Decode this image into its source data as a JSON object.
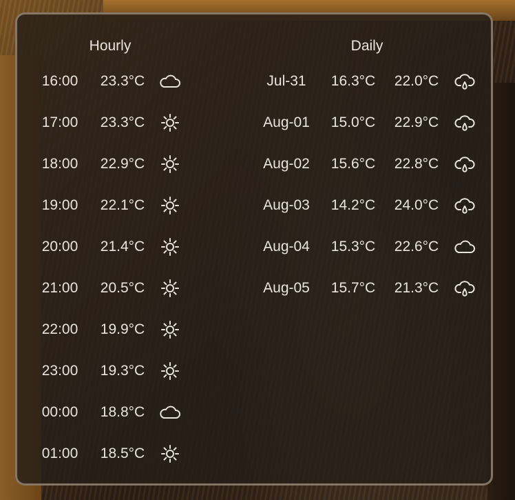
{
  "hourly": {
    "title": "Hourly",
    "rows": [
      {
        "time": "16:00",
        "temp": "23.3°C",
        "icon": "cloud-icon"
      },
      {
        "time": "17:00",
        "temp": "23.3°C",
        "icon": "sun-icon"
      },
      {
        "time": "18:00",
        "temp": "22.9°C",
        "icon": "sun-icon"
      },
      {
        "time": "19:00",
        "temp": "22.1°C",
        "icon": "sun-icon"
      },
      {
        "time": "20:00",
        "temp": "21.4°C",
        "icon": "sun-icon"
      },
      {
        "time": "21:00",
        "temp": "20.5°C",
        "icon": "sun-icon"
      },
      {
        "time": "22:00",
        "temp": "19.9°C",
        "icon": "sun-icon"
      },
      {
        "time": "23:00",
        "temp": "19.3°C",
        "icon": "sun-icon"
      },
      {
        "time": "00:00",
        "temp": "18.8°C",
        "icon": "cloud-icon"
      },
      {
        "time": "01:00",
        "temp": "18.5°C",
        "icon": "sun-icon"
      }
    ]
  },
  "daily": {
    "title": "Daily",
    "rows": [
      {
        "date": "Jul-31",
        "low": "16.3°C",
        "high": "22.0°C",
        "icon": "rain-cloud-icon"
      },
      {
        "date": "Aug-01",
        "low": "15.0°C",
        "high": "22.9°C",
        "icon": "rain-cloud-icon"
      },
      {
        "date": "Aug-02",
        "low": "15.6°C",
        "high": "22.8°C",
        "icon": "rain-cloud-icon"
      },
      {
        "date": "Aug-03",
        "low": "14.2°C",
        "high": "24.0°C",
        "icon": "rain-cloud-icon"
      },
      {
        "date": "Aug-04",
        "low": "15.3°C",
        "high": "22.6°C",
        "icon": "cloud-icon"
      },
      {
        "date": "Aug-05",
        "low": "15.7°C",
        "high": "21.3°C",
        "icon": "rain-cloud-icon"
      }
    ]
  },
  "colors": {
    "text": "#ebe4dd",
    "panel": "#261e18"
  }
}
